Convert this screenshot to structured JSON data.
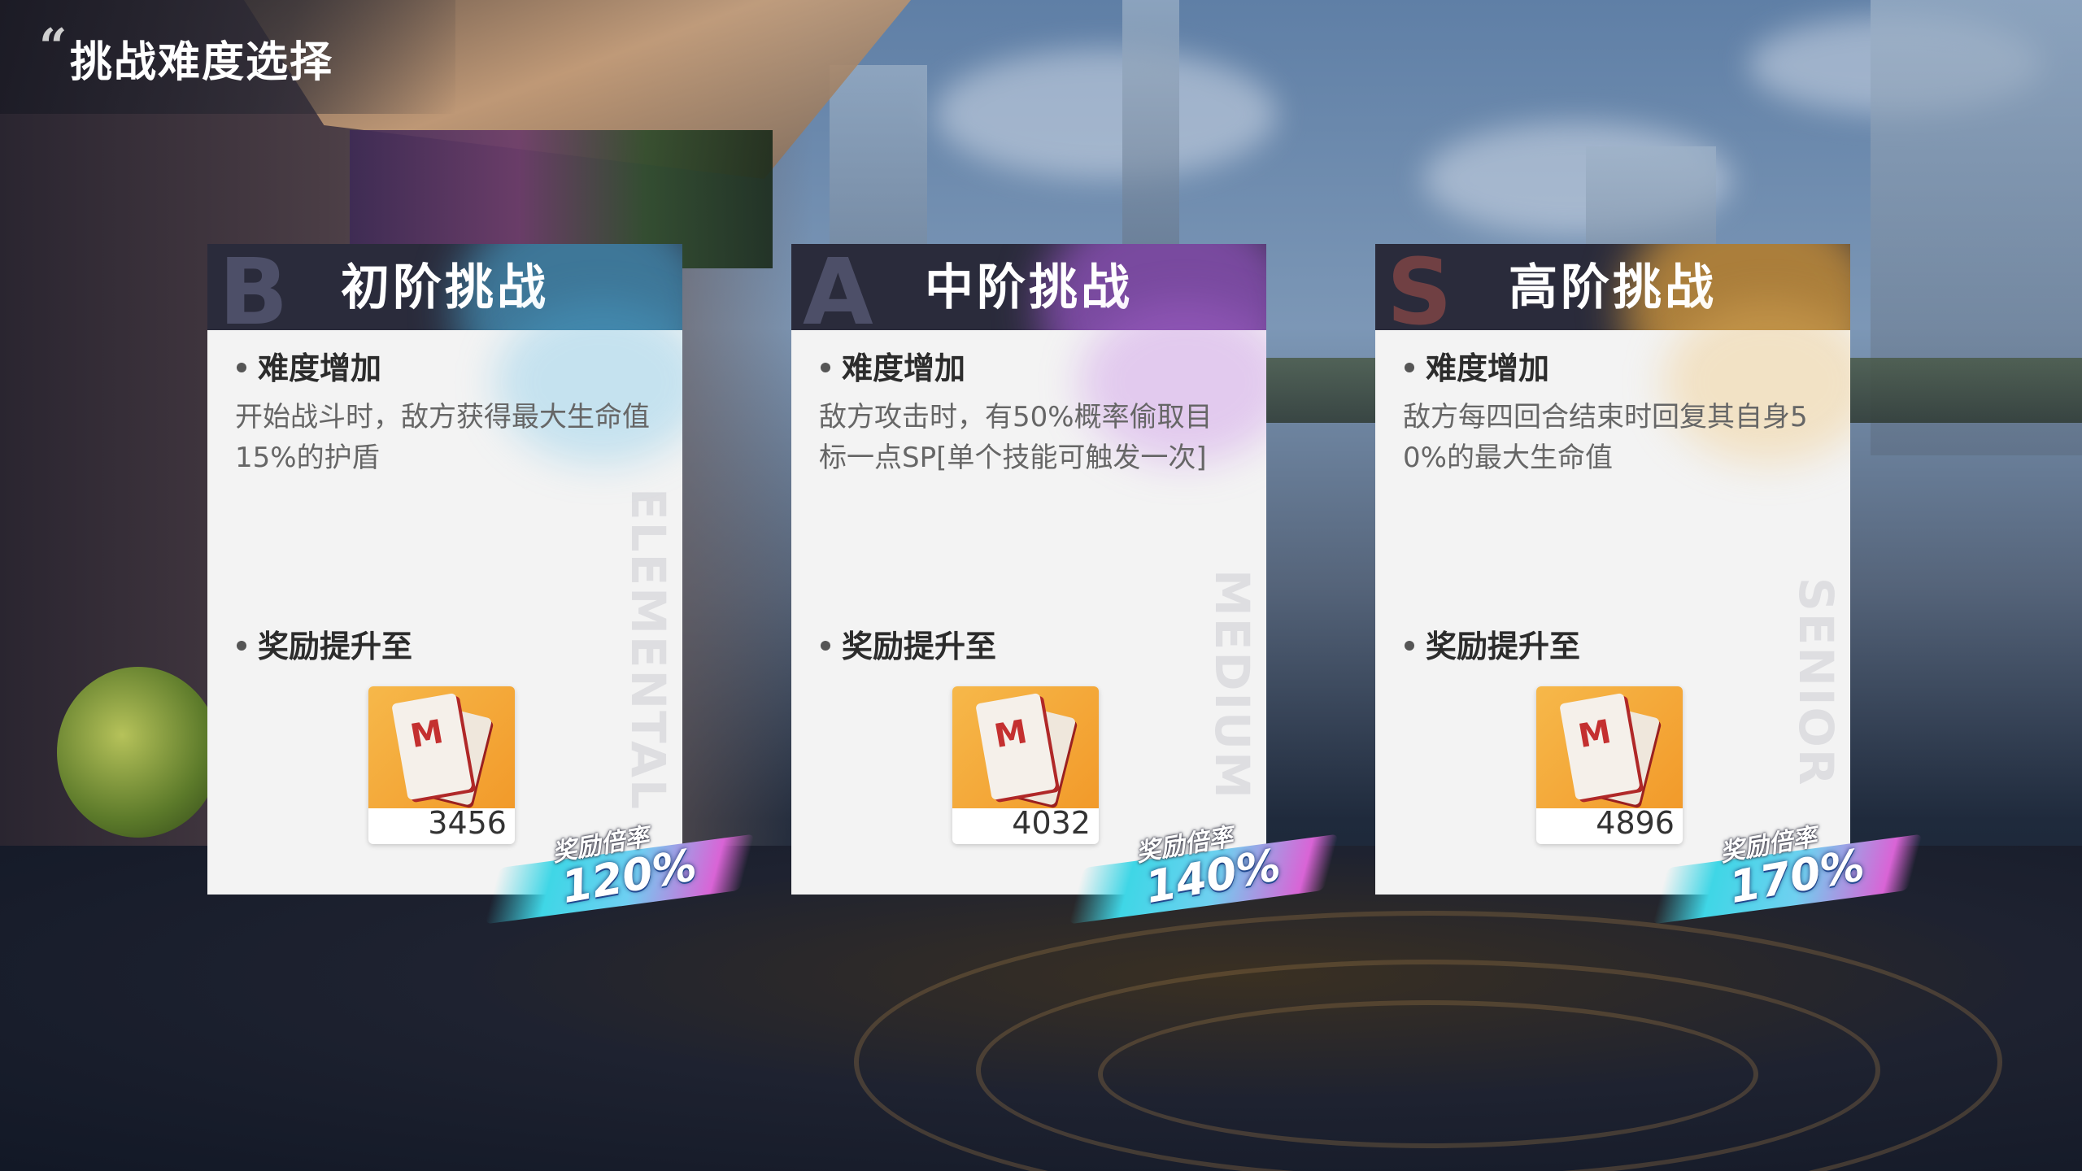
{
  "page": {
    "title": "挑战难度选择"
  },
  "cards": [
    {
      "letter": "B",
      "title": "初阶挑战",
      "vertical_label": "ELEMENTAL",
      "difficulty_heading": "难度增加",
      "difficulty_desc": "开始战斗时，敌方获得最大生命值15%的护盾",
      "reward_heading": "奖励提升至",
      "reward_count": "3456",
      "multiplier_label": "奖励倍率",
      "multiplier_value": "120%",
      "accent": "#4fb7e6"
    },
    {
      "letter": "A",
      "title": "中阶挑战",
      "vertical_label": "MEDIUM",
      "difficulty_heading": "难度增加",
      "difficulty_desc": "敌方攻击时，有50%概率偷取目标一点SP[单个技能可触发一次]",
      "reward_heading": "奖励提升至",
      "reward_count": "4032",
      "multiplier_label": "奖励倍率",
      "multiplier_value": "140%",
      "accent": "#a45ad6"
    },
    {
      "letter": "S",
      "title": "高阶挑战",
      "vertical_label": "SENIOR",
      "difficulty_heading": "难度增加",
      "difficulty_desc": "敌方每四回合结束时回复其自身50%的最大生命值",
      "reward_heading": "奖励提升至",
      "reward_count": "4896",
      "multiplier_label": "奖励倍率",
      "multiplier_value": "170%",
      "accent": "#e2a23c"
    }
  ]
}
